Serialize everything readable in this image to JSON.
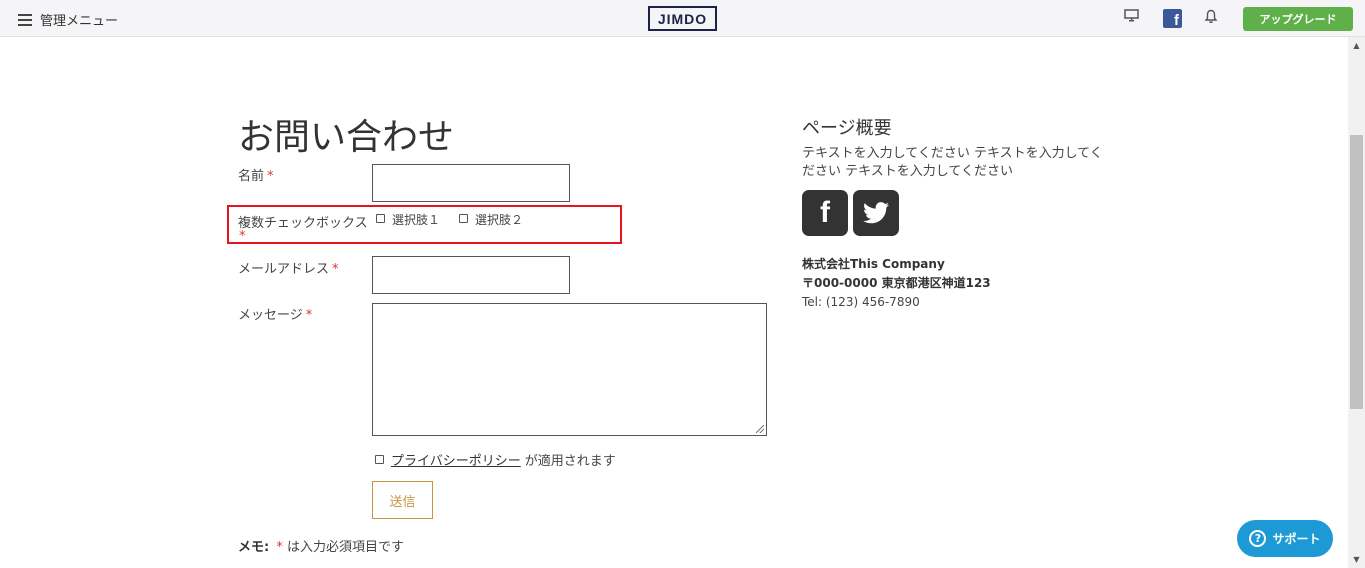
{
  "topbar": {
    "menu_label": "管理メニュー",
    "logo": "JIMDO",
    "fb_letter": "f",
    "upgrade_label": "アップグレード"
  },
  "form": {
    "title": "お問い合わせ",
    "required_mark": "*",
    "name_label": "名前",
    "checkbox_label": "複数チェックボックス",
    "options": [
      "選択肢１",
      "選択肢２"
    ],
    "email_label": "メールアドレス",
    "message_label": "メッセージ",
    "privacy_link": "プライバシーポリシー",
    "privacy_suffix": "が適用されます",
    "submit_label": "送信",
    "memo_prefix": "メモ:",
    "memo_suffix": "は入力必須項目です"
  },
  "sidebar": {
    "title": "ページ概要",
    "text": "テキストを入力してください テキストを入力してください テキストを入力してください",
    "company_name": "株式会社This Company",
    "address": "〒000-0000 東京都港区神道123",
    "tel": "Tel: (123) 456-7890",
    "fb_letter": "f"
  },
  "support": {
    "label": "サポート",
    "icon_glyph": "?"
  },
  "colors": {
    "upgrade": "#5fb04a",
    "support": "#1d9ad6",
    "highlight": "#e8141b",
    "submit": "#c8963e",
    "required": "#d33"
  }
}
